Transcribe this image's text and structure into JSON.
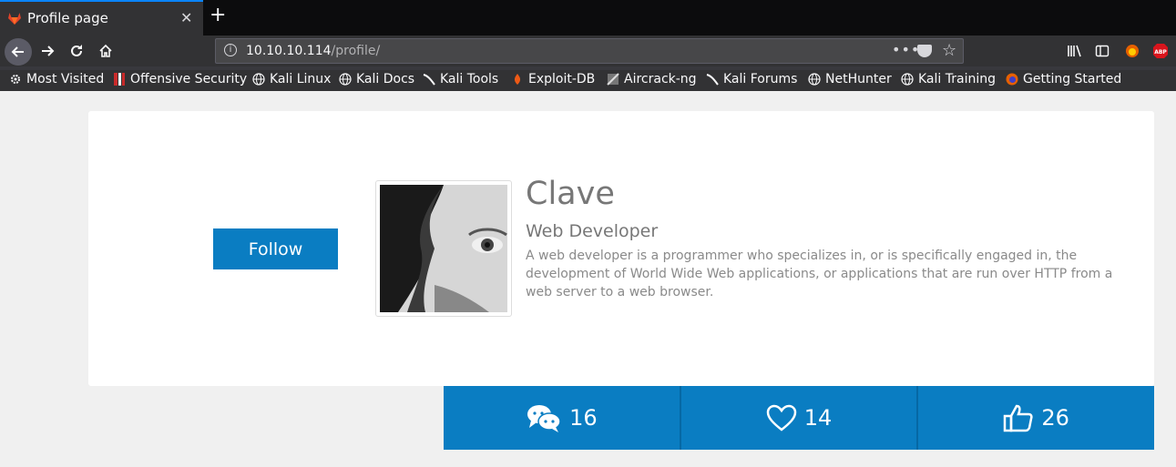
{
  "browser": {
    "tab_title": "Profile page",
    "url_host": "10.10.10.114",
    "url_path": "/profile/",
    "bookmarks": [
      {
        "label": "Most Visited",
        "icon": "gear-icon"
      },
      {
        "label": "Offensive Security",
        "icon": "offsec-icon"
      },
      {
        "label": "Kali Linux",
        "icon": "globe-icon"
      },
      {
        "label": "Kali Docs",
        "icon": "globe-icon"
      },
      {
        "label": "Kali Tools",
        "icon": "kali-dragon-icon"
      },
      {
        "label": "Exploit-DB",
        "icon": "exploitdb-icon"
      },
      {
        "label": "Aircrack-ng",
        "icon": "aircrack-icon"
      },
      {
        "label": "Kali Forums",
        "icon": "kali-dragon-icon"
      },
      {
        "label": "NetHunter",
        "icon": "globe-icon"
      },
      {
        "label": "Kali Training",
        "icon": "globe-icon"
      },
      {
        "label": "Getting Started",
        "icon": "firefox-icon"
      }
    ]
  },
  "profile": {
    "follow_label": "Follow",
    "name": "Clave",
    "role": "Web Developer",
    "description": "A web developer is a programmer who specializes in, or is specifically engaged in, the development of World Wide Web applications, or applications that are run over HTTP from a web server to a web browser."
  },
  "stats": {
    "messages": "16",
    "likes": "14",
    "thumbs": "26"
  },
  "colors": {
    "accent": "#0a7dc2",
    "background": "#f0f0f0"
  }
}
